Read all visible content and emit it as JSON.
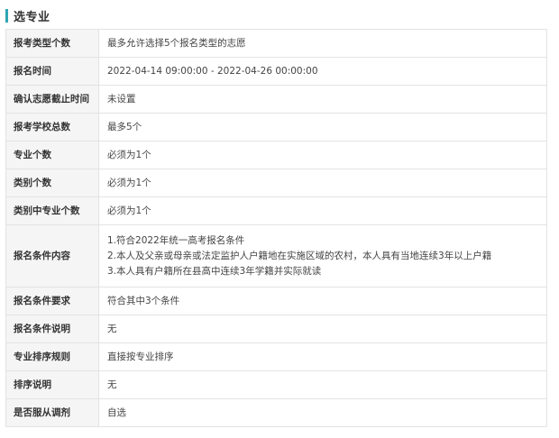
{
  "section": {
    "title": "选专业"
  },
  "rows": [
    {
      "label": "报考类型个数",
      "value": "最多允许选择5个报名类型的志愿"
    },
    {
      "label": "报名时间",
      "value": "2022-04-14 09:00:00 - 2022-04-26 00:00:00"
    },
    {
      "label": "确认志愿截止时间",
      "value": "未设置"
    },
    {
      "label": "报考学校总数",
      "value": "最多5个"
    },
    {
      "label": "专业个数",
      "value": "必须为1个"
    },
    {
      "label": "类别个数",
      "value": "必须为1个"
    },
    {
      "label": "类别中专业个数",
      "value": "必须为1个"
    },
    {
      "label": "报名条件内容",
      "lines": [
        "1.符合2022年统一高考报名条件",
        "2.本人及父亲或母亲或法定监护人户籍地在实施区域的农村，本人具有当地连续3年以上户籍",
        "3.本人具有户籍所在县高中连续3年学籍并实际就读"
      ]
    },
    {
      "label": "报名条件要求",
      "value": "符合其中3个条件"
    },
    {
      "label": "报名条件说明",
      "value": "无"
    },
    {
      "label": "专业排序规则",
      "value": "直接按专业排序"
    },
    {
      "label": "排序说明",
      "value": "无"
    },
    {
      "label": "是否服从调剂",
      "value": "自选"
    }
  ],
  "colors": {
    "accent_bar": "#2fa6b5",
    "label_bg": "#f5f5f5",
    "border": "#e3e3e3"
  }
}
